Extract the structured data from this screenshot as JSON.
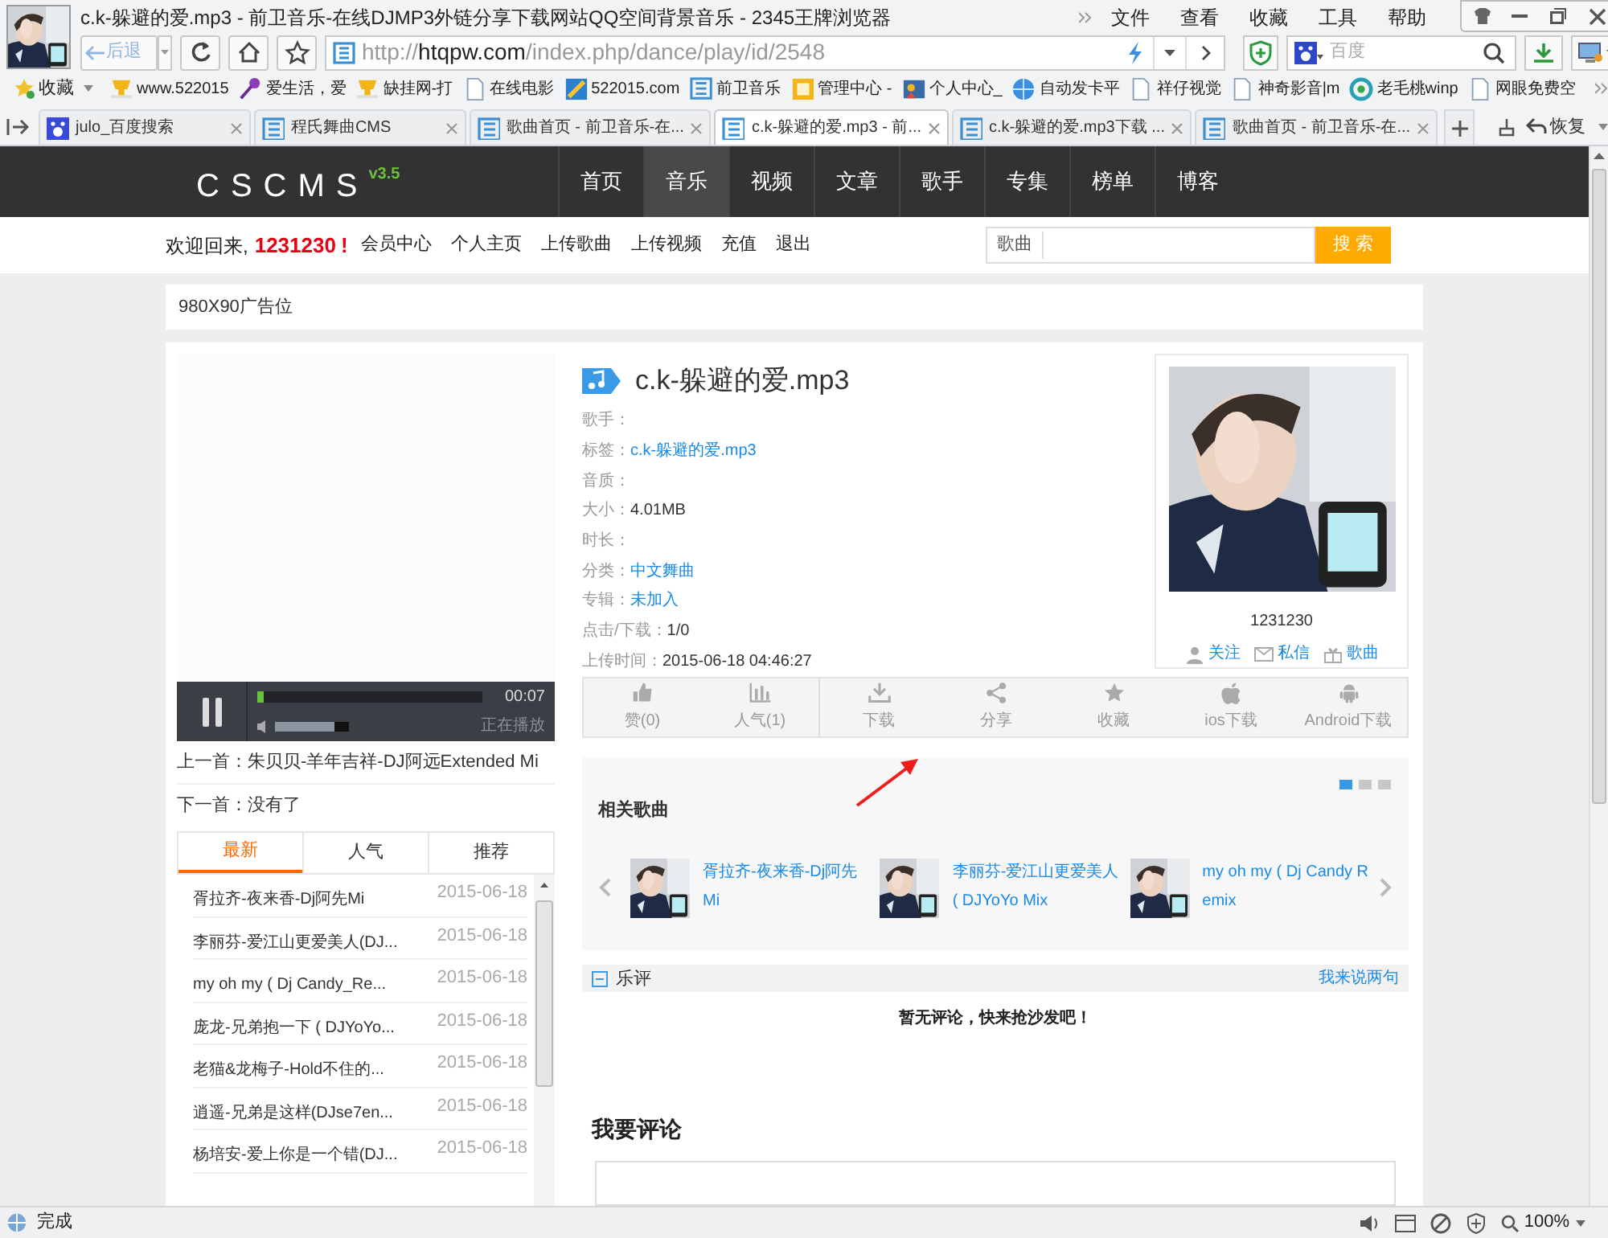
{
  "browser": {
    "title": "c.k-躲避的爱.mp3 - 前卫音乐-在线DJMP3外链分享下载网站QQ空间背景音乐 - 2345王牌浏览器",
    "menu": [
      "文件",
      "查看",
      "收藏",
      "工具",
      "帮助"
    ],
    "back": "后退",
    "address": {
      "scheme": "http://",
      "host": "htqpw.com",
      "path": "/index.php/dance/play/id/2548"
    },
    "search_placeholder": "百度"
  },
  "bookmarks": {
    "label": "收藏",
    "items": [
      {
        "label": "www.522015",
        "kind": "cup"
      },
      {
        "label": "爱生活，爱",
        "kind": "mic"
      },
      {
        "label": "缺挂网-打",
        "kind": "cup"
      },
      {
        "label": "在线电影",
        "kind": "page"
      },
      {
        "label": "522015.com",
        "kind": "tile"
      },
      {
        "label": "前卫音乐",
        "kind": "s"
      },
      {
        "label": "管理中心 -",
        "kind": "box"
      },
      {
        "label": "个人中心_",
        "kind": "people"
      },
      {
        "label": "自动发卡平",
        "kind": "globe"
      },
      {
        "label": "祥仔视觉",
        "kind": "page"
      },
      {
        "label": "神奇影音|m",
        "kind": "page"
      },
      {
        "label": "老毛桃winp",
        "kind": "ring"
      },
      {
        "label": "网眼免费空",
        "kind": "page"
      }
    ]
  },
  "tabs": [
    {
      "label": "julo_百度搜索",
      "kind": "paw",
      "selected": false
    },
    {
      "label": "程氏舞曲CMS",
      "kind": "s",
      "selected": false
    },
    {
      "label": "歌曲首页 - 前卫音乐-在...",
      "kind": "s",
      "selected": false
    },
    {
      "label": "c.k-躲避的爱.mp3 - 前...",
      "kind": "s",
      "selected": true
    },
    {
      "label": "c.k-躲避的爱.mp3下载 ...",
      "kind": "s",
      "selected": false
    },
    {
      "label": "歌曲首页 - 前卫音乐-在...",
      "kind": "s",
      "selected": false
    }
  ],
  "restore": "恢复",
  "site": {
    "logo": "CSCMS",
    "version": "v3.5",
    "nav": [
      {
        "label": "首页",
        "selected": false
      },
      {
        "label": "音乐",
        "selected": true
      },
      {
        "label": "视频",
        "selected": false
      },
      {
        "label": "文章",
        "selected": false
      },
      {
        "label": "歌手",
        "selected": false
      },
      {
        "label": "专集",
        "selected": false
      },
      {
        "label": "榜单",
        "selected": false
      },
      {
        "label": "博客",
        "selected": false
      }
    ],
    "welcome": "欢迎回来,",
    "username": "1231230",
    "exclaim": "!",
    "user_links": [
      "会员中心",
      "个人主页",
      "上传歌曲",
      "上传视频",
      "充值",
      "退出"
    ],
    "search": {
      "category": "歌曲",
      "button": "搜 索"
    },
    "ad": "980X90广告位"
  },
  "player": {
    "time": "00:07",
    "status": "正在播放",
    "progress": {
      "level": 0.03
    },
    "volume": {
      "level": 0.8
    }
  },
  "prev": "上一首：朱贝贝-羊年吉祥-DJ阿远Extended Mi",
  "next": "下一首：没有了",
  "list_tabs": [
    {
      "label": "最新",
      "selected": true
    },
    {
      "label": "人气",
      "selected": false
    },
    {
      "label": "推荐",
      "selected": false
    }
  ],
  "list": [
    {
      "title": "胥拉齐-夜来香-Dj阿先Mi",
      "date": "2015-06-18"
    },
    {
      "title": "李丽芬-爱江山更爱美人(DJ...",
      "date": "2015-06-18"
    },
    {
      "title": "my oh my ( Dj Candy_Re...",
      "date": "2015-06-18"
    },
    {
      "title": "庞龙-兄弟抱一下 ( DJYoYo...",
      "date": "2015-06-18"
    },
    {
      "title": "老猫&龙梅子-Hold不住的...",
      "date": "2015-06-18"
    },
    {
      "title": "逍遥-兄弟是这样(DJse7en...",
      "date": "2015-06-18"
    },
    {
      "title": "杨培安-爱上你是一个错(DJ...",
      "date": "2015-06-18"
    }
  ],
  "song": {
    "title": "c.k-躲避的爱.mp3",
    "fields": [
      {
        "label": "歌手："
      },
      {
        "label": "标签：",
        "value": "c.k-躲避的爱.mp3",
        "link": true
      },
      {
        "label": "音质："
      },
      {
        "label": "大小：",
        "value": "4.01MB",
        "link": false
      },
      {
        "label": "时长："
      },
      {
        "label": "分类：",
        "value": "中文舞曲",
        "link": true
      },
      {
        "label": "专辑：",
        "value": "未加入",
        "link": true
      },
      {
        "label": "点击/下载：",
        "value": "1/0",
        "link": false
      },
      {
        "label": "上传时间：",
        "value": "2015-06-18 04:46:27",
        "link": false
      }
    ]
  },
  "uploader": {
    "name": "1231230",
    "actions": [
      {
        "label": "关注",
        "kind": "user"
      },
      {
        "label": "私信",
        "kind": "mail"
      },
      {
        "label": "歌曲",
        "kind": "gift"
      }
    ]
  },
  "actions": [
    {
      "label": "赞(0)",
      "kind": "thumb",
      "divider_before": false
    },
    {
      "label": "人气(1)",
      "kind": "bars",
      "divider_before": false
    },
    {
      "label": "下载",
      "kind": "download",
      "divider_before": true
    },
    {
      "label": "分享",
      "kind": "share",
      "divider_before": false
    },
    {
      "label": "收藏",
      "kind": "star",
      "divider_before": false
    },
    {
      "label": "ios下载",
      "kind": "apple",
      "divider_before": false
    },
    {
      "label": "Android下载",
      "kind": "android",
      "divider_before": false
    }
  ],
  "related": {
    "title": "相关歌曲",
    "pages": [
      {
        "selected": true
      },
      {
        "selected": false
      },
      {
        "selected": false
      }
    ],
    "items": [
      {
        "title": "胥拉齐-夜来香-Dj阿先Mi"
      },
      {
        "title": "李丽芬-爱江山更爱美人( DJYoYo Mix"
      },
      {
        "title": "my oh my ( Dj Candy Remix"
      }
    ]
  },
  "comments": {
    "title": "乐评",
    "link": "我来说两句",
    "empty": "暂无评论，快来抢沙发吧！",
    "form_title": "我要评论"
  },
  "status": {
    "text": "完成",
    "zoom": "100%"
  }
}
